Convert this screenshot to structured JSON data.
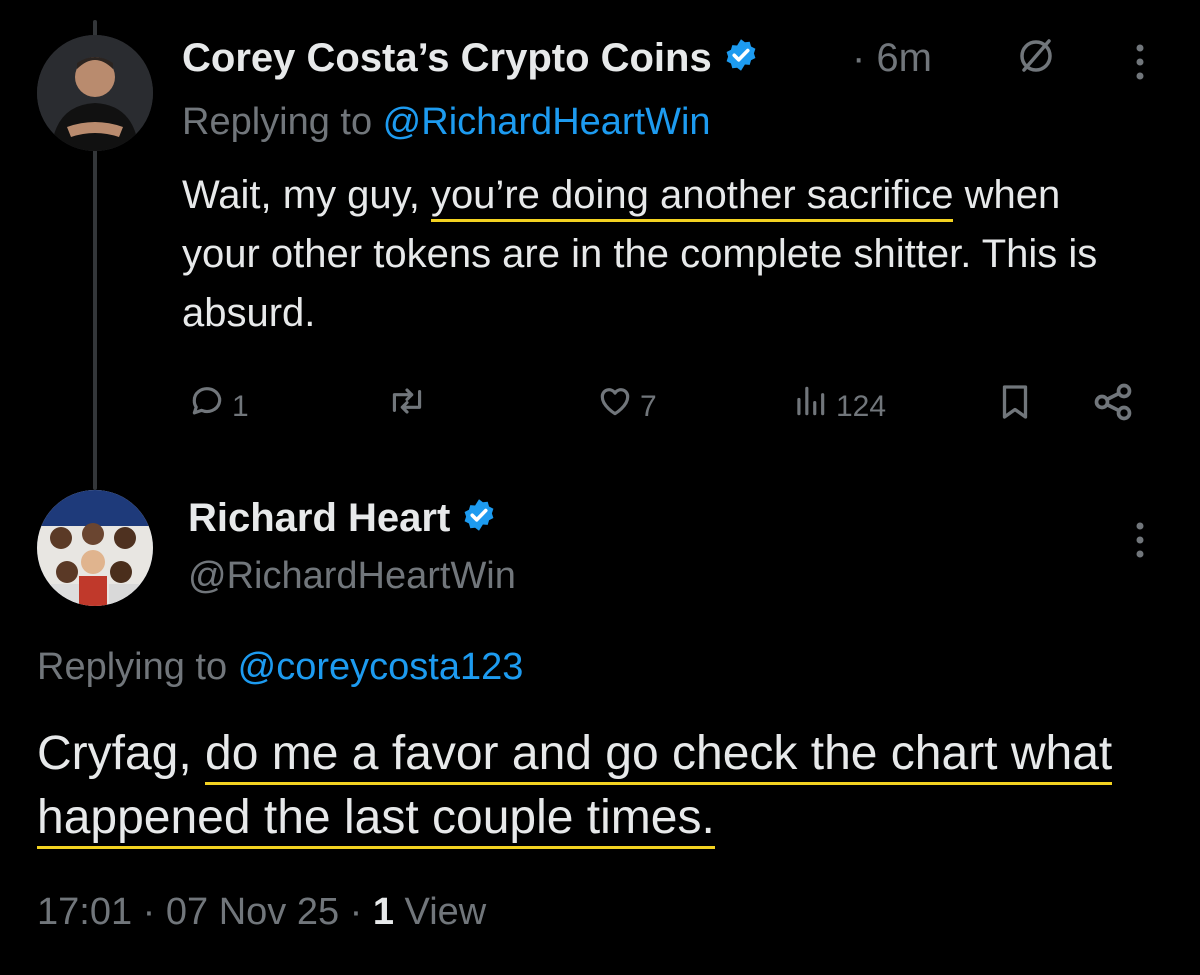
{
  "tweet1": {
    "author_name": "Corey Costa’s Crypto Coins",
    "time": "· 6m",
    "replying_prefix": "Replying to ",
    "replying_handle": "@RichardHeartWin",
    "text_before": "Wait, my guy, ",
    "text_highlight": "you’re doing another sacrifice",
    "text_after": " when your other tokens are in the complete shitter. This is absurd.",
    "replies": "1",
    "likes": "7",
    "views": "124"
  },
  "tweet2": {
    "author_name": "Richard Heart",
    "handle": "@RichardHeartWin",
    "replying_prefix": "Replying to ",
    "replying_handle": "@coreycosta123",
    "text_before": "Cryfag, ",
    "text_highlight": "do me a favor and go check the chart what happened the last couple times.",
    "timestamp": "17:01 · 07 Nov 25 · ",
    "views_count": "1",
    "views_label": " View"
  },
  "icons": [
    "verified-badge",
    "mute-icon",
    "more-icon",
    "reply-icon",
    "retweet-icon",
    "like-icon",
    "views-icon",
    "bookmark-icon",
    "share-icon"
  ],
  "colors": {
    "background": "#000000",
    "link": "#1d9bf0",
    "verified": "#1d9bf0",
    "highlight": "#f3d221",
    "muted": "#71767b"
  }
}
